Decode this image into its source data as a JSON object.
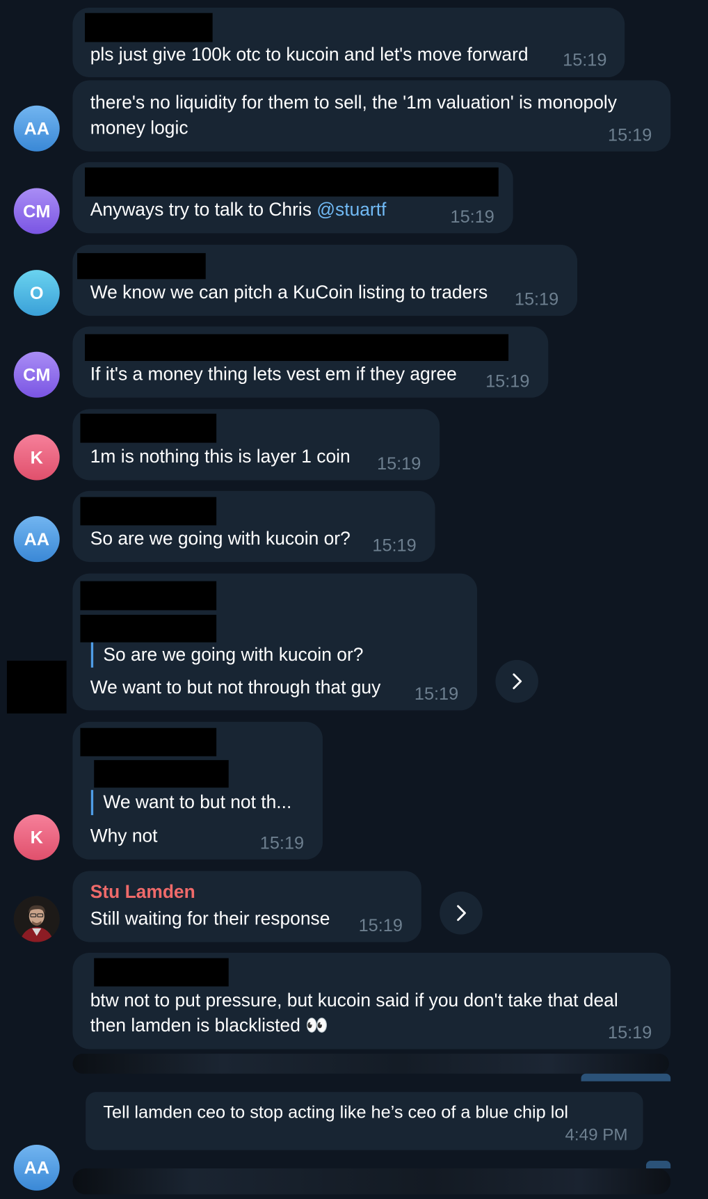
{
  "messages": [
    {
      "text": "pls just give 100k otc to kucoin and let's move forward",
      "time": "15:19"
    },
    {
      "avatar": "AA",
      "text_line1": "there's no liquidity for them to sell, the '1m valuation' is monopoly",
      "text_line2": "money logic",
      "time": "15:19"
    },
    {
      "avatar": "CM",
      "text": "Anyways try to talk to Chris ",
      "mention": "@stuartf",
      "time": "15:19"
    },
    {
      "avatar": "O",
      "text": "We know we can pitch a KuCoin listing to traders",
      "time": "15:19"
    },
    {
      "avatar": "CM",
      "text": "If it's a money thing lets vest em if they agree",
      "time": "15:19"
    },
    {
      "avatar": "K",
      "text": "1m is nothing this is layer 1 coin",
      "time": "15:19"
    },
    {
      "avatar": "AA",
      "text": "So are we going with kucoin or?",
      "time": "15:19"
    },
    {
      "quote": "So are we going with kucoin or?",
      "text": "We want to but not through that guy",
      "time": "15:19"
    },
    {
      "avatar": "K",
      "quote": "We want to but not th...",
      "text": "Why not",
      "time": "15:19"
    },
    {
      "sender": "Stu Lamden",
      "text": "Still waiting for their response",
      "time": "15:19"
    },
    {
      "text_line1": "btw not to put pressure, but kucoin said if you don't take that deal",
      "text_line2": "then lamden is blacklisted 👀",
      "time": "15:19"
    },
    {
      "avatar": "AA",
      "text": "Tell lamden ceo to stop acting like he’s ceo of a blue chip lol",
      "time": "4:49 PM"
    }
  ],
  "icons": {
    "forward": "chevron-right-icon",
    "user_photo": "user-photo-avatar"
  },
  "colors": {
    "background": "#0e1621",
    "bubble": "#182533",
    "mention": "#71baf5",
    "sender": "#ef6a6a",
    "time": "#6d7f8f"
  }
}
